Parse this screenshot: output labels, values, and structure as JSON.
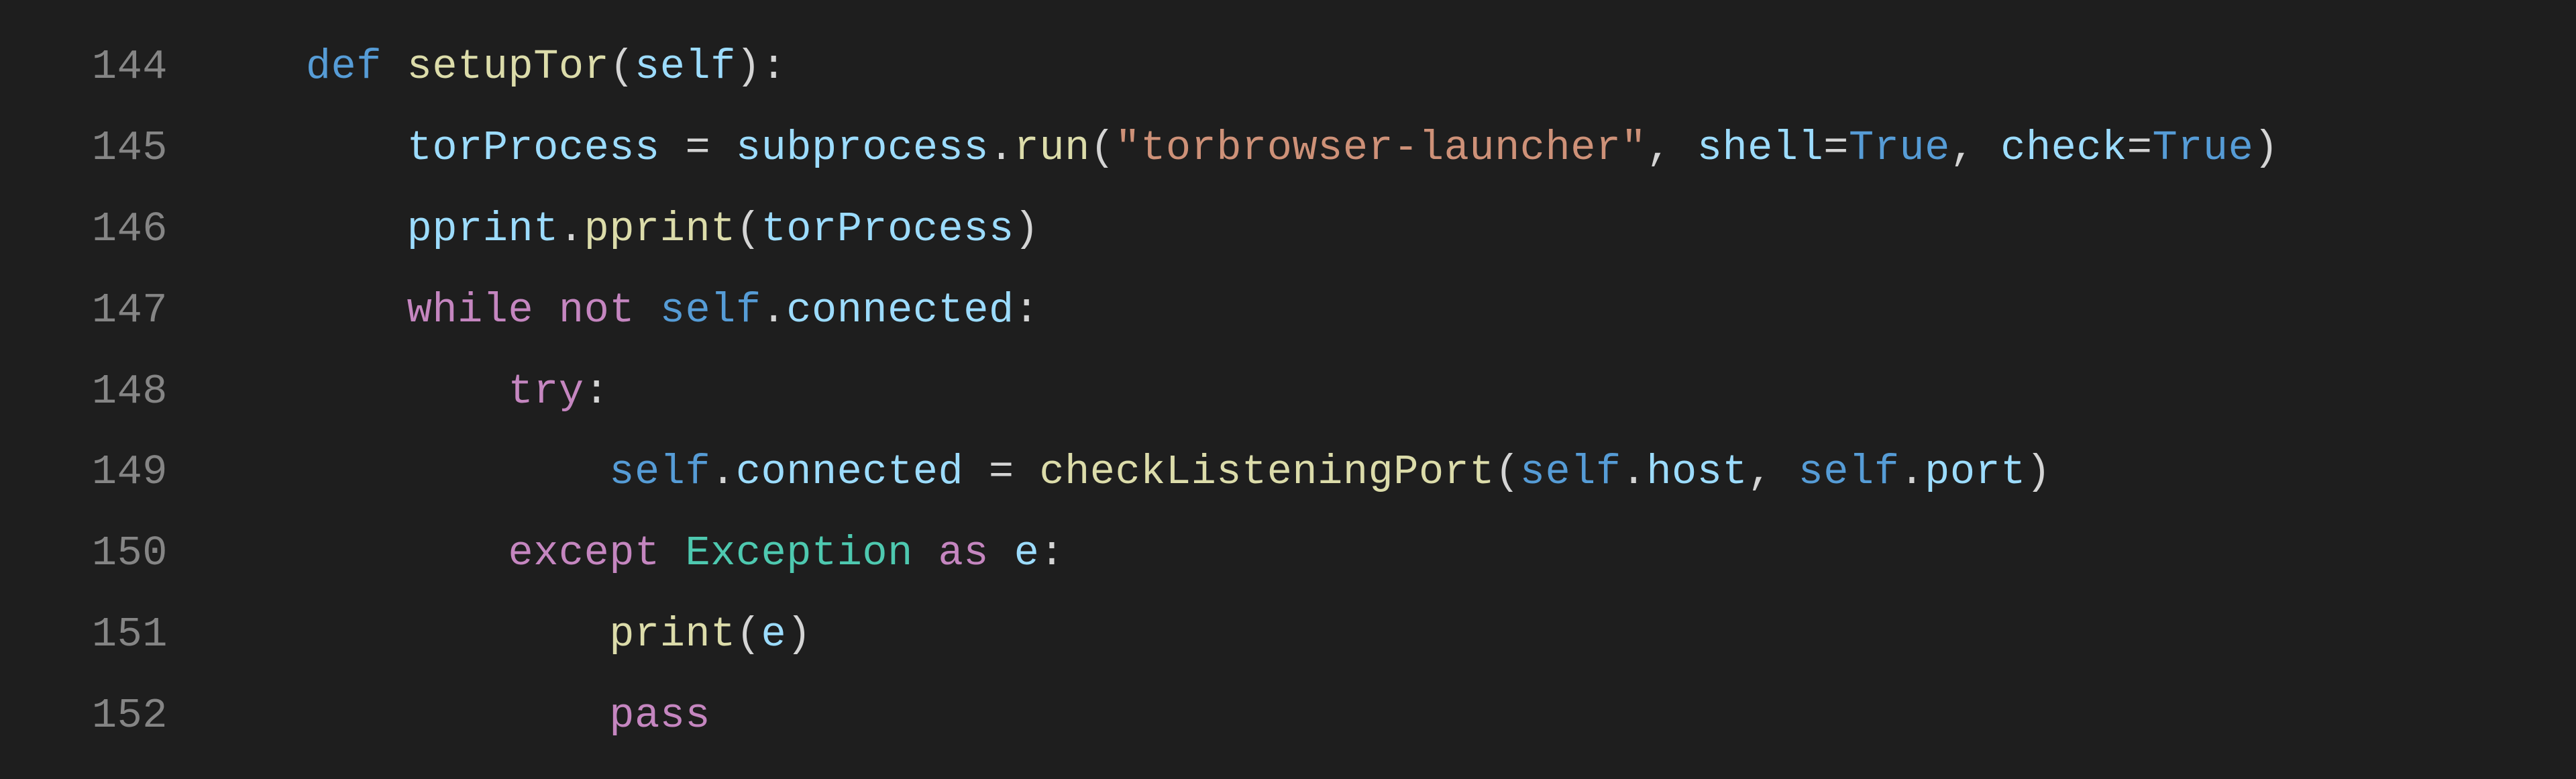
{
  "lines": [
    {
      "num": "144",
      "indent": "    ",
      "tokens": [
        {
          "cls": "tok-def",
          "t": "def"
        },
        {
          "cls": "tok-plain",
          "t": " "
        },
        {
          "cls": "tok-fn",
          "t": "setupTor"
        },
        {
          "cls": "tok-punc",
          "t": "("
        },
        {
          "cls": "tok-param",
          "t": "self"
        },
        {
          "cls": "tok-punc",
          "t": "):"
        }
      ]
    },
    {
      "num": "145",
      "indent": "        ",
      "tokens": [
        {
          "cls": "tok-var",
          "t": "torProcess"
        },
        {
          "cls": "tok-plain",
          "t": " "
        },
        {
          "cls": "tok-punc",
          "t": "="
        },
        {
          "cls": "tok-plain",
          "t": " "
        },
        {
          "cls": "tok-var",
          "t": "subprocess"
        },
        {
          "cls": "tok-punc",
          "t": "."
        },
        {
          "cls": "tok-fn",
          "t": "run"
        },
        {
          "cls": "tok-punc",
          "t": "("
        },
        {
          "cls": "tok-str",
          "t": "\"torbrowser-launcher\""
        },
        {
          "cls": "tok-punc",
          "t": ", "
        },
        {
          "cls": "tok-param",
          "t": "shell"
        },
        {
          "cls": "tok-punc",
          "t": "="
        },
        {
          "cls": "tok-const",
          "t": "True"
        },
        {
          "cls": "tok-punc",
          "t": ", "
        },
        {
          "cls": "tok-param",
          "t": "check"
        },
        {
          "cls": "tok-punc",
          "t": "="
        },
        {
          "cls": "tok-const",
          "t": "True"
        },
        {
          "cls": "tok-punc",
          "t": ")"
        }
      ]
    },
    {
      "num": "146",
      "indent": "        ",
      "tokens": [
        {
          "cls": "tok-var",
          "t": "pprint"
        },
        {
          "cls": "tok-punc",
          "t": "."
        },
        {
          "cls": "tok-fn",
          "t": "pprint"
        },
        {
          "cls": "tok-punc",
          "t": "("
        },
        {
          "cls": "tok-var",
          "t": "torProcess"
        },
        {
          "cls": "tok-punc",
          "t": ")"
        }
      ]
    },
    {
      "num": "147",
      "indent": "        ",
      "tokens": [
        {
          "cls": "tok-kw",
          "t": "while"
        },
        {
          "cls": "tok-plain",
          "t": " "
        },
        {
          "cls": "tok-kw",
          "t": "not"
        },
        {
          "cls": "tok-plain",
          "t": " "
        },
        {
          "cls": "tok-self",
          "t": "self"
        },
        {
          "cls": "tok-punc",
          "t": "."
        },
        {
          "cls": "tok-prop",
          "t": "connected"
        },
        {
          "cls": "tok-punc",
          "t": ":"
        }
      ]
    },
    {
      "num": "148",
      "indent": "            ",
      "tokens": [
        {
          "cls": "tok-kw",
          "t": "try"
        },
        {
          "cls": "tok-punc",
          "t": ":"
        }
      ]
    },
    {
      "num": "149",
      "indent": "                ",
      "tokens": [
        {
          "cls": "tok-self",
          "t": "self"
        },
        {
          "cls": "tok-punc",
          "t": "."
        },
        {
          "cls": "tok-prop",
          "t": "connected"
        },
        {
          "cls": "tok-plain",
          "t": " "
        },
        {
          "cls": "tok-punc",
          "t": "="
        },
        {
          "cls": "tok-plain",
          "t": " "
        },
        {
          "cls": "tok-fn",
          "t": "checkListeningPort"
        },
        {
          "cls": "tok-punc",
          "t": "("
        },
        {
          "cls": "tok-self",
          "t": "self"
        },
        {
          "cls": "tok-punc",
          "t": "."
        },
        {
          "cls": "tok-prop",
          "t": "host"
        },
        {
          "cls": "tok-punc",
          "t": ", "
        },
        {
          "cls": "tok-self",
          "t": "self"
        },
        {
          "cls": "tok-punc",
          "t": "."
        },
        {
          "cls": "tok-prop",
          "t": "port"
        },
        {
          "cls": "tok-punc",
          "t": ")"
        }
      ]
    },
    {
      "num": "150",
      "indent": "            ",
      "tokens": [
        {
          "cls": "tok-kw",
          "t": "except"
        },
        {
          "cls": "tok-plain",
          "t": " "
        },
        {
          "cls": "tok-class",
          "t": "Exception"
        },
        {
          "cls": "tok-plain",
          "t": " "
        },
        {
          "cls": "tok-kw",
          "t": "as"
        },
        {
          "cls": "tok-plain",
          "t": " "
        },
        {
          "cls": "tok-var",
          "t": "e"
        },
        {
          "cls": "tok-punc",
          "t": ":"
        }
      ]
    },
    {
      "num": "151",
      "indent": "                ",
      "tokens": [
        {
          "cls": "tok-fn",
          "t": "print"
        },
        {
          "cls": "tok-punc",
          "t": "("
        },
        {
          "cls": "tok-var",
          "t": "e"
        },
        {
          "cls": "tok-punc",
          "t": ")"
        }
      ]
    },
    {
      "num": "152",
      "indent": "                ",
      "tokens": [
        {
          "cls": "tok-kw",
          "t": "pass"
        }
      ]
    }
  ]
}
